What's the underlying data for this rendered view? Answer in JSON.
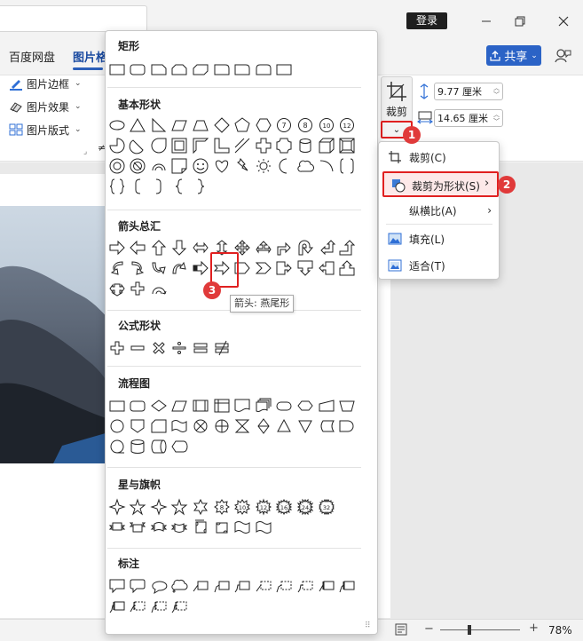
{
  "titlebar": {
    "login_label": "登录"
  },
  "ribbon_tabs": [
    "百度网盘",
    "图片格"
  ],
  "share": {
    "label": "共享"
  },
  "ribbon": {
    "border_label": "图片边框",
    "effect_label": "图片效果",
    "layout_label": "图片版式",
    "crop_label": "裁剪",
    "height_value": "9.77 厘米",
    "width_value": "14.65 厘米"
  },
  "gallery": {
    "sections": {
      "rect": "矩形",
      "basic": "基本形状",
      "arrows": "箭头总汇",
      "equation": "公式形状",
      "flowchart": "流程图",
      "stars": "星与旗帜",
      "callouts": "标注"
    },
    "tooltip": "箭头: 燕尾形"
  },
  "context_menu": {
    "items": [
      {
        "label": "裁剪(C)",
        "icon": "crop-icon"
      },
      {
        "label": "裁剪为形状(S)",
        "icon": "shape-icon",
        "has_submenu": true
      },
      {
        "label": "纵横比(A)",
        "icon": "",
        "has_submenu": true
      },
      {
        "label": "填充(L)",
        "icon": "fill-picture-icon"
      },
      {
        "label": "适合(T)",
        "icon": "fit-picture-icon"
      }
    ]
  },
  "steps": [
    "1",
    "2",
    "3"
  ],
  "statusbar": {
    "zoom": "78%"
  },
  "colors": {
    "accent": "#2b63c6",
    "highlight_red": "#e02020",
    "badge_red": "#e03a3a"
  }
}
